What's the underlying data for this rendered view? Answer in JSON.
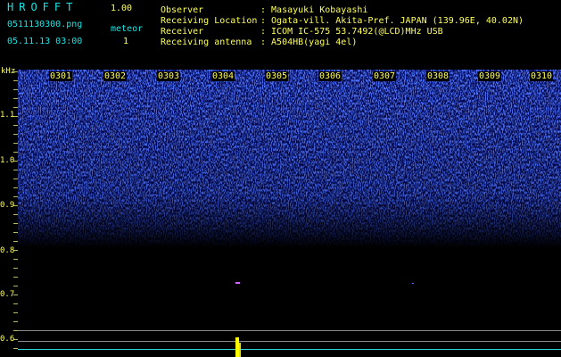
{
  "header": {
    "app_name": "HROFFT",
    "version": "1.00",
    "filename": "0511130300.png",
    "datetime": "05.11.13 03:00",
    "meteor_label": "meteor",
    "meteor_count": "1",
    "fields": [
      {
        "label": "Observer",
        "value": ": Masayuki Kobayashi"
      },
      {
        "label": "Receiving Location",
        "value": ": Ogata-vill. Akita-Pref. JAPAN (139.96E, 40.02N)"
      },
      {
        "label": "Receiver",
        "value": ": ICOM IC-575 53.7492(@LCD)MHz USB"
      },
      {
        "label": "Receiving antenna",
        "value": ": A504HB(yagi 4el)"
      }
    ]
  },
  "axis": {
    "unit": "kHz",
    "y_ticks": [
      "1.1",
      "1.0",
      "0.9",
      "0.8",
      "0.7",
      "0.6"
    ],
    "x_ticks": [
      "0301",
      "0302",
      "0303",
      "0304",
      "0305",
      "0306",
      "0307",
      "0308",
      "0309",
      "0310"
    ]
  },
  "colors": {
    "background": "#000000",
    "label_cyan": "#19e6e6",
    "label_yellow": "#ffff5a",
    "noise_blue": "#2a3cff",
    "signal_yellow": "#ffff00"
  }
}
